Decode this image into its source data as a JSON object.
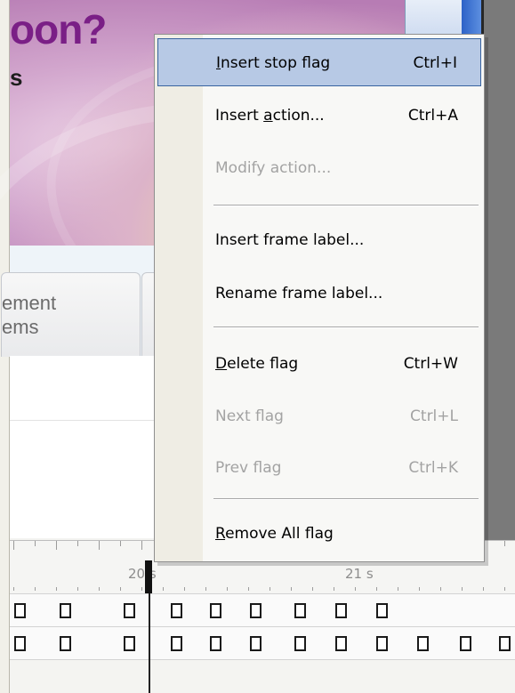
{
  "banner": {
    "title": "oon?",
    "subtitle": "s"
  },
  "tabs": [
    {
      "label": "ement\nems"
    }
  ],
  "timeline": {
    "ruler_labels": [
      "20 s",
      "21 s"
    ]
  },
  "context_menu": {
    "items": [
      {
        "label": "Insert stop flag",
        "accel": "I",
        "shortcut": "Ctrl+I",
        "enabled": true,
        "selected": true
      },
      {
        "label": "Insert action...",
        "accel": "a",
        "shortcut": "Ctrl+A",
        "enabled": true,
        "selected": false
      },
      {
        "label": "Modify action...",
        "accel": "",
        "shortcut": "",
        "enabled": false,
        "selected": false
      },
      {
        "label": "Insert frame label...",
        "accel": "",
        "shortcut": "",
        "enabled": true,
        "selected": false
      },
      {
        "label": "Rename frame label...",
        "accel": "",
        "shortcut": "",
        "enabled": true,
        "selected": false
      },
      {
        "label": "Delete flag",
        "accel": "D",
        "shortcut": "Ctrl+W",
        "enabled": true,
        "selected": false
      },
      {
        "label": "Next flag",
        "accel": "",
        "shortcut": "Ctrl+L",
        "enabled": false,
        "selected": false
      },
      {
        "label": "Prev flag",
        "accel": "",
        "shortcut": "Ctrl+K",
        "enabled": false,
        "selected": false
      },
      {
        "label": "Remove All flag",
        "accel": "R",
        "shortcut": "",
        "enabled": true,
        "selected": false
      }
    ]
  },
  "colors": {
    "banner_title": "#7a1f86",
    "menu_highlight": "#b7c9e5",
    "menu_disabled_text": "#a3a3a3"
  }
}
